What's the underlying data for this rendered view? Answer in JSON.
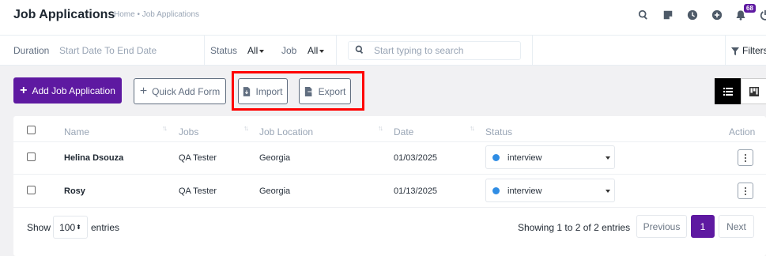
{
  "header": {
    "title": "Job Applications",
    "breadcrumb": "Home • Job Applications",
    "notification_count": "68",
    "icons": [
      "search-icon",
      "sticky-note-icon",
      "clock-icon",
      "plus-circle-icon",
      "bell-icon",
      "power-icon"
    ]
  },
  "filters": {
    "duration_label": "Duration",
    "duration_value": "Start Date To End Date",
    "status_label": "Status",
    "status_value": "All",
    "job_label": "Job",
    "job_value": "All",
    "search_placeholder": "Start typing to search",
    "filters_label": "Filters"
  },
  "actions": {
    "add_label": "Add Job Application",
    "quick_add_label": "Quick Add Form",
    "import_label": "Import",
    "export_label": "Export"
  },
  "table": {
    "columns": [
      "Name",
      "Jobs",
      "Job Location",
      "Date",
      "Status",
      "Action"
    ],
    "rows": [
      {
        "name": "Helina Dsouza",
        "job": "QA Tester",
        "location": "Georgia",
        "date": "01/03/2025",
        "status": "interview"
      },
      {
        "name": "Rosy",
        "job": "QA Tester",
        "location": "Georgia",
        "date": "01/13/2025",
        "status": "interview"
      }
    ]
  },
  "footer": {
    "show_label": "Show",
    "entries_value": "100",
    "entries_label": "entries",
    "summary": "Showing 1 to 2 of 2 entries",
    "previous_label": "Previous",
    "current_page": "1",
    "next_label": "Next"
  },
  "colors": {
    "brand": "#5e19a1",
    "status_dot": "#2f8de4",
    "highlight": "#ff0000"
  }
}
